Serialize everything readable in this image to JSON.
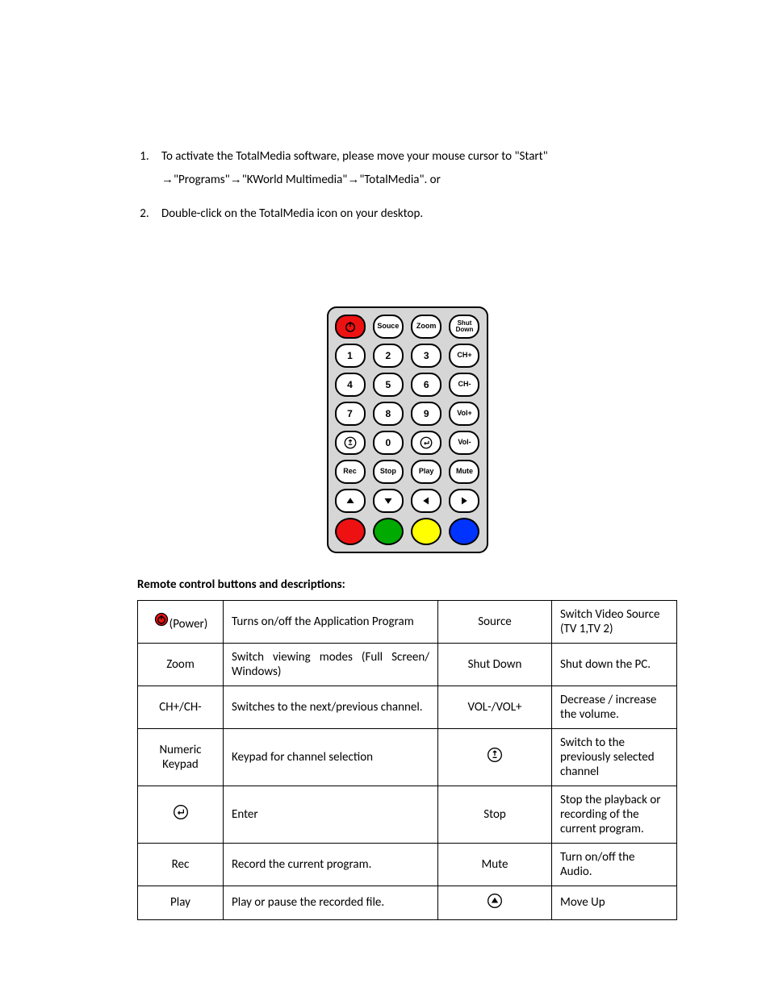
{
  "instructions": {
    "item1_a": "To activate the TotalMedia software, please move your mouse cursor to \"Start\"",
    "item1_b": "\"Programs\"",
    "item1_c": "\"KWorld Multimedia\"",
    "item1_d": "\"TotalMedia\". or",
    "item2": "Double-click on the TotalMedia icon on your desktop."
  },
  "remote": {
    "row0": [
      "",
      "Souce",
      "Zoom",
      "Shut\nDown"
    ],
    "row1": [
      "1",
      "2",
      "3",
      "CH+"
    ],
    "row2": [
      "4",
      "5",
      "6",
      "CH-"
    ],
    "row3": [
      "7",
      "8",
      "9",
      "Vol+"
    ],
    "row4": [
      "",
      "0",
      "",
      "Vol-"
    ],
    "row5": [
      "Rec",
      "Stop",
      "Play",
      "Mute"
    ]
  },
  "section_heading": "Remote control buttons and descriptions:",
  "table": {
    "r0": {
      "a_text": "(Power)",
      "b": "Turns on/off the Application Program",
      "c": "Source",
      "d": "Switch Video Source (TV 1,TV 2)"
    },
    "r1": {
      "a": "Zoom",
      "b": "Switch viewing modes (Full Screen/ Windows)",
      "c": "Shut Down",
      "d": "Shut down the PC."
    },
    "r2": {
      "a": "CH+/CH-",
      "b": "Switches to the next/previous channel.",
      "c": "VOL-/VOL+",
      "d": "Decrease / increase the volume."
    },
    "r3": {
      "a": "Numeric Keypad",
      "b": "Keypad for channel selection",
      "d": "Switch to the previously selected channel"
    },
    "r4": {
      "b": "Enter",
      "c": "Stop",
      "d": "Stop the playback or recording of the current program."
    },
    "r5": {
      "a": "Rec",
      "b": "Record the current program.",
      "c": "Mute",
      "d": "Turn on/off the Audio."
    },
    "r6": {
      "a": "Play",
      "b": "Play or pause the recorded file.",
      "d": "Move Up"
    }
  }
}
